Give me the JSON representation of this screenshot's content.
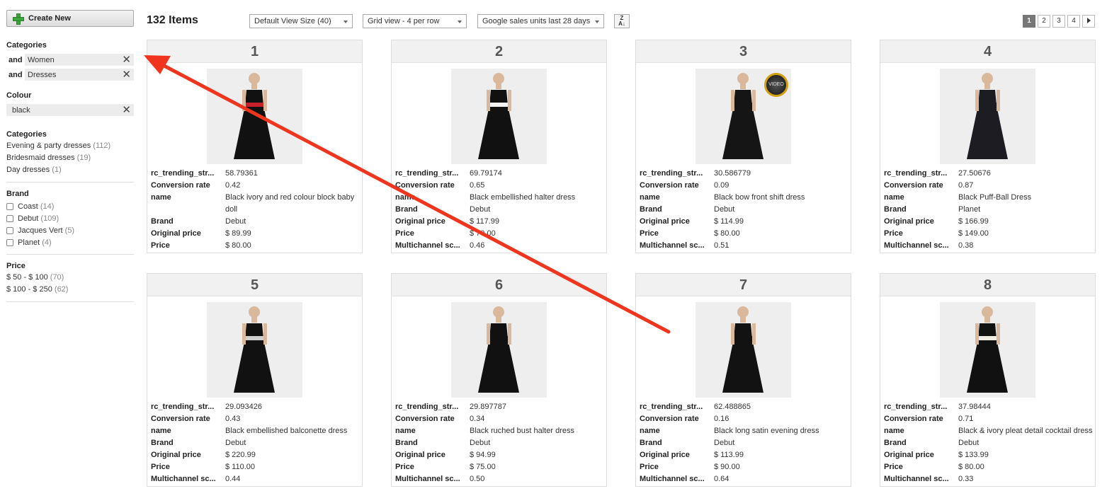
{
  "toolbar": {
    "create_label": "Create New",
    "items_count": "132 Items",
    "view_size": "Default View Size (40)",
    "grid_view": "Grid view - 4 per row",
    "sort_by": "Google sales units last 28 days",
    "sort_icon": "sort-z-a-icon",
    "pages": [
      "1",
      "2",
      "3",
      "4"
    ]
  },
  "sidebar": {
    "active_categories_title": "Categories",
    "active_categories": [
      {
        "op": "and",
        "label": "Women"
      },
      {
        "op": "and",
        "label": "Dresses"
      }
    ],
    "colour_title": "Colour",
    "colour_filter": "black",
    "categories_title": "Categories",
    "categories": [
      {
        "label": "Evening & party dresses",
        "count": "(112)"
      },
      {
        "label": "Bridesmaid dresses",
        "count": "(19)"
      },
      {
        "label": "Day dresses",
        "count": "(1)"
      }
    ],
    "brand_title": "Brand",
    "brands": [
      {
        "label": "Coast",
        "count": "(14)"
      },
      {
        "label": "Debut",
        "count": "(109)"
      },
      {
        "label": "Jacques Vert",
        "count": "(5)"
      },
      {
        "label": "Planet",
        "count": "(4)"
      }
    ],
    "price_title": "Price",
    "prices": [
      {
        "label": "$ 50 - $ 100",
        "count": "(70)"
      },
      {
        "label": "$ 100 - $ 250",
        "count": "(62)"
      }
    ]
  },
  "products": [
    {
      "rank": "1",
      "video": false,
      "dress_color": "#111111",
      "accent": "#c8202a",
      "attrs": [
        [
          "rc_trending_str...",
          "58.79361"
        ],
        [
          "Conversion rate",
          "0.42"
        ],
        [
          "name",
          "Black ivory and red colour block baby doll"
        ],
        [
          "Brand",
          "Debut"
        ],
        [
          "Original price",
          "$ 89.99"
        ],
        [
          "Price",
          "$ 80.00"
        ]
      ]
    },
    {
      "rank": "2",
      "video": false,
      "dress_color": "#111111",
      "accent": "#f2f2f2",
      "attrs": [
        [
          "rc_trending_str...",
          "69.79174"
        ],
        [
          "Conversion rate",
          "0.65"
        ],
        [
          "name",
          "Black embellished halter dress"
        ],
        [
          "Brand",
          "Debut"
        ],
        [
          "Original price",
          "$ 117.99"
        ],
        [
          "Price",
          "$ 70.00"
        ],
        [
          "Multichannel sc...",
          "0.46"
        ]
      ]
    },
    {
      "rank": "3",
      "video": true,
      "video_label": "VIDEO",
      "dress_color": "#151515",
      "accent": "#151515",
      "attrs": [
        [
          "rc_trending_str...",
          "30.586779"
        ],
        [
          "Conversion rate",
          "0.09"
        ],
        [
          "name",
          "Black bow front shift dress"
        ],
        [
          "Brand",
          "Debut"
        ],
        [
          "Original price",
          "$ 114.99"
        ],
        [
          "Price",
          "$ 80.00"
        ],
        [
          "Multichannel sc...",
          "0.51"
        ]
      ]
    },
    {
      "rank": "4",
      "video": false,
      "dress_color": "#1c1c22",
      "accent": "#1c1c22",
      "attrs": [
        [
          "rc_trending_str...",
          "27.50676"
        ],
        [
          "Conversion rate",
          "0.87"
        ],
        [
          "name",
          "Black Puff-Ball Dress"
        ],
        [
          "Brand",
          "Planet"
        ],
        [
          "Original price",
          "$ 166.99"
        ],
        [
          "Price",
          "$ 149.00"
        ],
        [
          "Multichannel sc...",
          "0.38"
        ]
      ]
    },
    {
      "rank": "5",
      "video": false,
      "dress_color": "#111111",
      "accent": "#cfcfcf",
      "attrs": [
        [
          "rc_trending_str...",
          "29.093426"
        ],
        [
          "Conversion rate",
          "0.43"
        ],
        [
          "name",
          "Black embellished balconette dress"
        ],
        [
          "Brand",
          "Debut"
        ],
        [
          "Original price",
          "$ 220.99"
        ],
        [
          "Price",
          "$ 110.00"
        ],
        [
          "Multichannel sc...",
          "0.44"
        ]
      ]
    },
    {
      "rank": "6",
      "video": false,
      "dress_color": "#111111",
      "accent": "#111111",
      "attrs": [
        [
          "rc_trending_str...",
          "29.897787"
        ],
        [
          "Conversion rate",
          "0.34"
        ],
        [
          "name",
          "Black ruched bust halter dress"
        ],
        [
          "Brand",
          "Debut"
        ],
        [
          "Original price",
          "$ 94.99"
        ],
        [
          "Price",
          "$ 75.00"
        ],
        [
          "Multichannel sc...",
          "0.50"
        ]
      ]
    },
    {
      "rank": "7",
      "video": false,
      "dress_color": "#121212",
      "accent": "#121212",
      "attrs": [
        [
          "rc_trending_str...",
          "62.488865"
        ],
        [
          "Conversion rate",
          "0.16"
        ],
        [
          "name",
          "Black long satin evening dress"
        ],
        [
          "Brand",
          "Debut"
        ],
        [
          "Original price",
          "$ 113.99"
        ],
        [
          "Price",
          "$ 90.00"
        ],
        [
          "Multichannel sc...",
          "0.64"
        ]
      ]
    },
    {
      "rank": "8",
      "video": false,
      "dress_color": "#111111",
      "accent": "#f0ece4",
      "attrs": [
        [
          "rc_trending_str...",
          "37.98444"
        ],
        [
          "Conversion rate",
          "0.71"
        ],
        [
          "name",
          "Black & ivory pleat detail cocktail dress"
        ],
        [
          "Brand",
          "Debut"
        ],
        [
          "Original price",
          "$ 133.99"
        ],
        [
          "Price",
          "$ 80.00"
        ],
        [
          "Multichannel sc...",
          "0.33"
        ]
      ]
    }
  ],
  "annotation": {
    "arrow_color": "#f0351f"
  }
}
